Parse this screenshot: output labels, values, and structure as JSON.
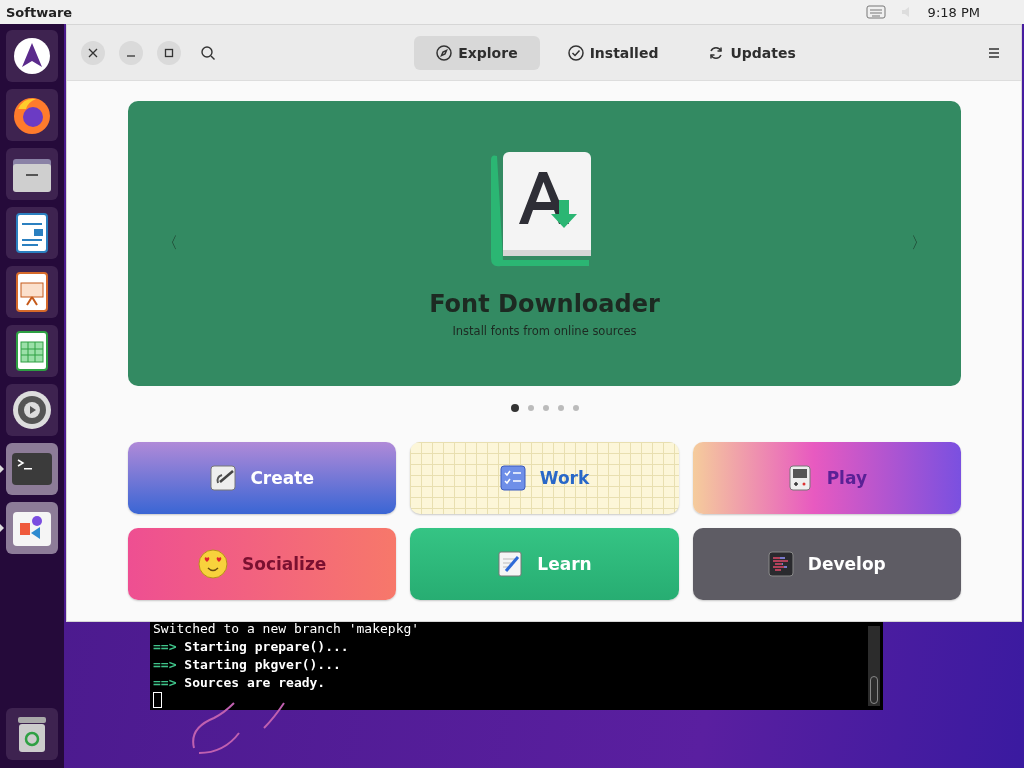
{
  "top_bar": {
    "app_name": "Software",
    "clock": "9:18 PM"
  },
  "dock": {
    "items": [
      {
        "kind": "launcher",
        "running": false
      },
      {
        "kind": "browser",
        "running": false
      },
      {
        "kind": "files",
        "running": false
      },
      {
        "kind": "writer",
        "running": false
      },
      {
        "kind": "impress",
        "running": false
      },
      {
        "kind": "calc",
        "running": false
      },
      {
        "kind": "settings",
        "running": false
      },
      {
        "kind": "terminal",
        "running": true
      },
      {
        "kind": "software",
        "running": true
      }
    ],
    "trash": {
      "kind": "trash"
    }
  },
  "window": {
    "tabs": [
      {
        "label": "Explore",
        "kind": "compass",
        "selected": true
      },
      {
        "label": "Installed",
        "kind": "check",
        "selected": false
      },
      {
        "label": "Updates",
        "kind": "refresh",
        "selected": false
      }
    ],
    "featured": {
      "title": "Font Downloader",
      "subtitle": "Install fonts from online sources",
      "prev": "〈",
      "next": "〉",
      "pages": [
        {
          "selected": true
        },
        {
          "selected": false
        },
        {
          "selected": false
        },
        {
          "selected": false
        },
        {
          "selected": false
        }
      ]
    },
    "categories": [
      {
        "label": "Create",
        "kind": "create"
      },
      {
        "label": "Work",
        "kind": "work"
      },
      {
        "label": "Play",
        "kind": "play"
      },
      {
        "label": "Socialize",
        "kind": "socialize"
      },
      {
        "label": "Learn",
        "kind": "learn"
      },
      {
        "label": "Develop",
        "kind": "develop"
      }
    ]
  },
  "terminal": {
    "lines": [
      {
        "text": "Switched to a new branch 'makepkg'"
      },
      {
        "prompt": "==>",
        "text": "Starting prepare()..."
      },
      {
        "prompt": "==>",
        "text": "Starting pkgver()..."
      },
      {
        "prompt": "==>",
        "text": "Sources are ready."
      }
    ]
  }
}
